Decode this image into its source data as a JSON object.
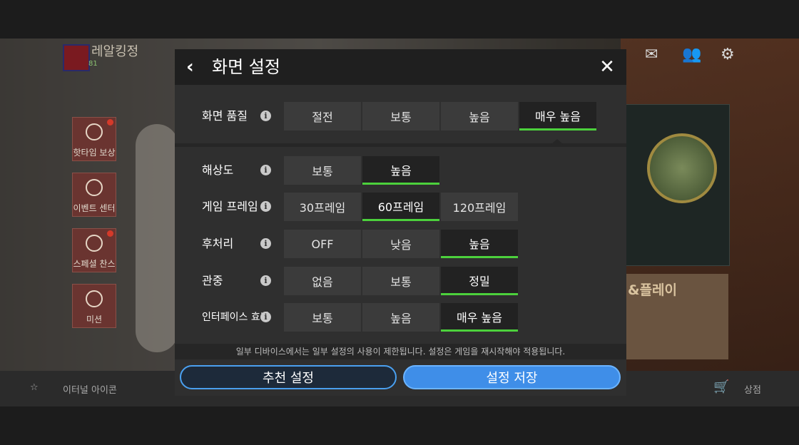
{
  "background": {
    "club_name": "레알킹정",
    "club_level": "81",
    "promo_text": "&플레이",
    "tiles": [
      {
        "label": "핫타임 보상",
        "icon": "stopwatch-icon",
        "badge": true
      },
      {
        "label": "이벤트 센터",
        "icon": "firework-icon",
        "badge": false
      },
      {
        "label": "스페셜 찬스",
        "icon": "chest-icon",
        "badge": true
      },
      {
        "label": "미션",
        "icon": "soccer-ball-icon",
        "badge": false
      }
    ],
    "nav": {
      "left_label": "이터널 아이콘",
      "right_label": "상점"
    }
  },
  "modal": {
    "title": "화면 설정",
    "back_icon": "‹",
    "close_icon": "✕",
    "info_glyph": "i",
    "settings": [
      {
        "label": "화면 품질",
        "options": [
          "절전",
          "보통",
          "높음",
          "매우 높음"
        ],
        "selected": 3
      },
      {
        "label": "해상도",
        "options": [
          "보통",
          "높음"
        ],
        "selected": 1
      },
      {
        "label": "게임 프레임",
        "options": [
          "30프레임",
          "60프레임",
          "120프레임"
        ],
        "selected": 1
      },
      {
        "label": "후처리",
        "options": [
          "OFF",
          "낮음",
          "높음"
        ],
        "selected": 2
      },
      {
        "label": "관중",
        "options": [
          "없음",
          "보통",
          "정밀"
        ],
        "selected": 2
      },
      {
        "label": "인터페이스 효과",
        "options": [
          "보통",
          "높음",
          "매우 높음"
        ],
        "selected": 2
      }
    ],
    "notice": "일부 디바이스에서는 일부 설정의 사용이 제한됩니다. 설정은 게임을 재시작해야 적용됩니다.",
    "recommend_button": "추천 설정",
    "save_button": "설정 저장"
  },
  "colors": {
    "accent_green": "#4cd13c",
    "button_blue": "#3f8ee8"
  }
}
